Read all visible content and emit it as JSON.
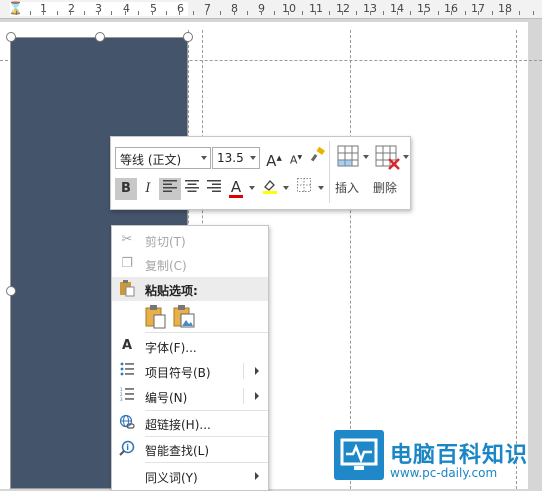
{
  "ruler": {
    "numbers": [
      "1",
      "2",
      "3",
      "4",
      "5",
      "6",
      "7",
      "8",
      "9",
      "10",
      "11",
      "12",
      "13",
      "14",
      "15",
      "16",
      "17",
      "18"
    ]
  },
  "mini_toolbar": {
    "font_name": "等线 (正文)",
    "font_size": "13.5",
    "grow_font": "A",
    "shrink_font": "A",
    "bold": "B",
    "italic": "I",
    "font_color_label": "A",
    "insert_label": "插入",
    "delete_label": "删除",
    "font_color": "#e00000",
    "highlight_color": "#ffff00"
  },
  "context_menu": {
    "items": [
      {
        "label": "剪切(T)",
        "icon": "scissors-icon",
        "disabled": true
      },
      {
        "label": "复制(C)",
        "icon": "copy-icon",
        "disabled": true
      },
      {
        "label": "粘贴选项:",
        "icon": "paste-icon",
        "disabled": false
      },
      {
        "label": "字体(F)...",
        "icon": "font-icon",
        "disabled": false
      },
      {
        "label": "项目符号(B)",
        "icon": "bullets-icon",
        "disabled": false
      },
      {
        "label": "编号(N)",
        "icon": "numbering-icon",
        "disabled": false
      },
      {
        "label": "超链接(H)...",
        "icon": "hyperlink-icon",
        "disabled": false
      },
      {
        "label": "智能查找(L)",
        "icon": "smart-lookup-icon",
        "disabled": false
      },
      {
        "label": "同义词(Y)",
        "icon": "thesaurus-icon",
        "disabled": false
      }
    ]
  },
  "watermark": {
    "title": "电脑百科知识",
    "url": "www.pc-daily.com"
  },
  "colors": {
    "sidebar": "#44546a",
    "watermark": "#1a86c6"
  }
}
